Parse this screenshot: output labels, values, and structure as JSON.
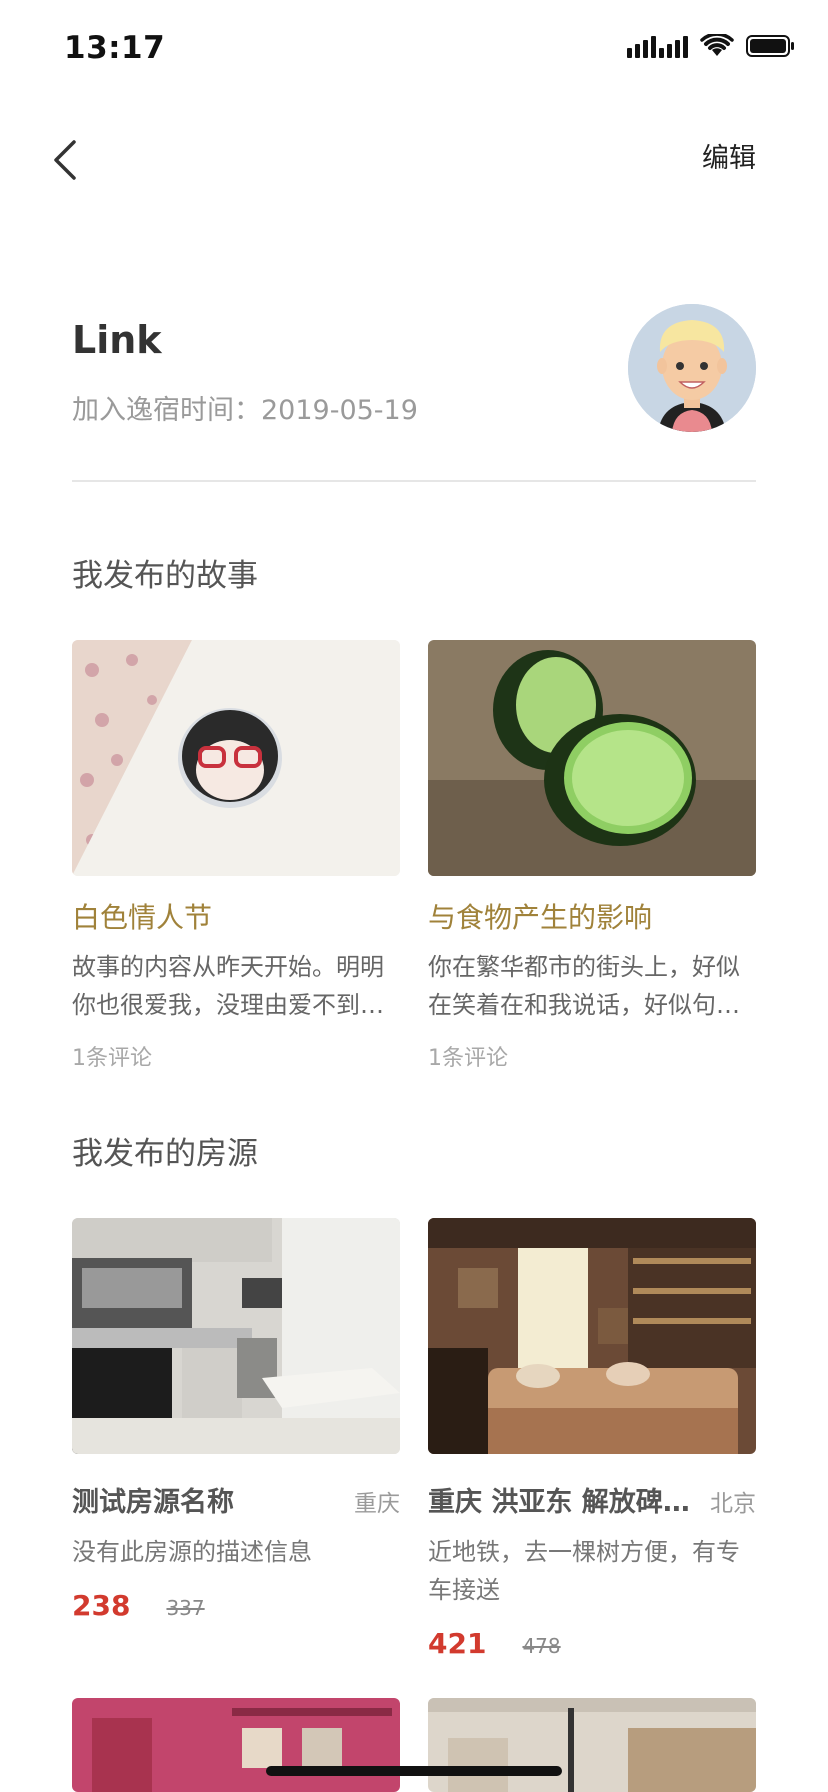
{
  "status_bar": {
    "time": "13:17"
  },
  "nav": {
    "edit_label": "编辑"
  },
  "profile": {
    "name": "Link",
    "join_label": "加入逸宿时间：",
    "join_date": "2019-05-19"
  },
  "stories": {
    "section_title": "我发布的故事",
    "items": [
      {
        "title": "白色情人节",
        "body": "故事的内容从昨天开始。明明你也很爱我，没理由爱不到一起",
        "comments": "1条评论"
      },
      {
        "title": "与食物产生的影响",
        "body": "你在繁华都市的街头上，好似在笑着在和我说话，好似句句都",
        "comments": "1条评论"
      }
    ]
  },
  "houses": {
    "section_title": "我发布的房源",
    "items": [
      {
        "title": "测试房源名称",
        "city": "重庆",
        "desc": "没有此房源的描述信息",
        "price": "238",
        "original_price": "337"
      },
      {
        "title": "重庆 洪亚东 解放碑 时尚公寓",
        "city": "北京",
        "desc": "近地铁，去一棵树方便，有专车接送",
        "price": "421",
        "original_price": "478"
      }
    ]
  },
  "colors": {
    "accent_title": "#a0823a",
    "price": "#d23a2e"
  }
}
